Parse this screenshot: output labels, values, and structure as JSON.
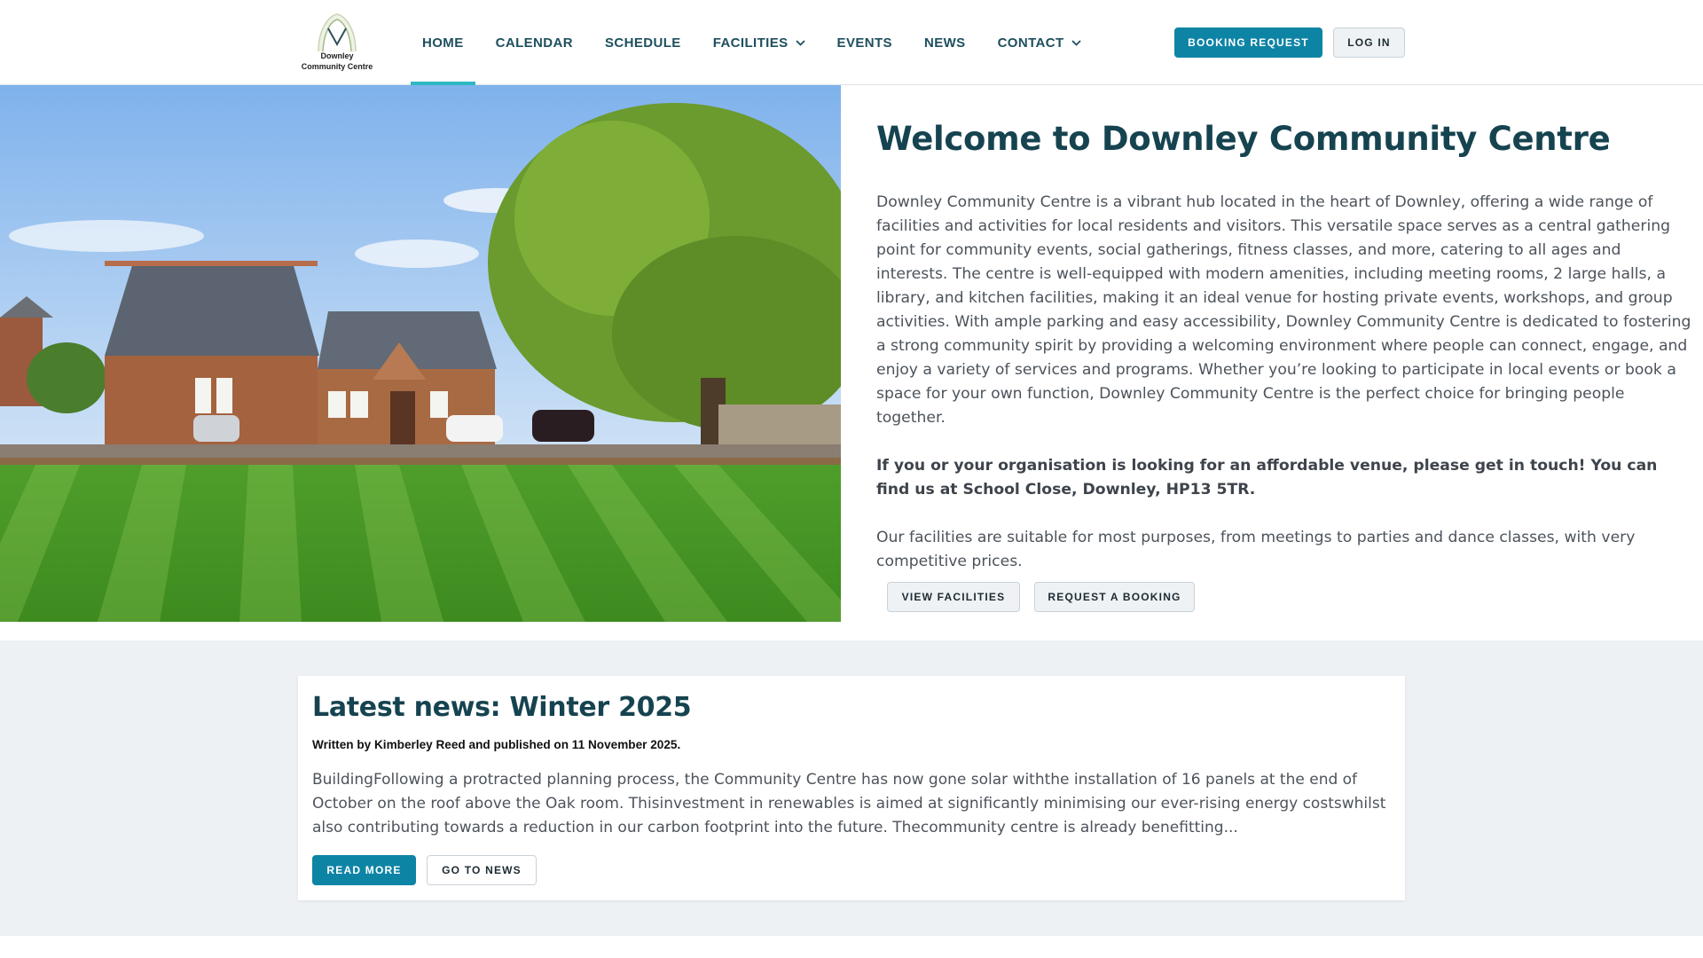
{
  "logo": {
    "line1": "Downley",
    "line2": "Community Centre"
  },
  "nav": {
    "items": [
      {
        "label": "HOME",
        "active": true
      },
      {
        "label": "CALENDAR"
      },
      {
        "label": "SCHEDULE"
      },
      {
        "label": "FACILITIES",
        "dropdown": true
      },
      {
        "label": "EVENTS"
      },
      {
        "label": "NEWS"
      },
      {
        "label": "CONTACT",
        "dropdown": true
      }
    ],
    "booking_label": "BOOKING REQUEST",
    "login_label": "LOG IN"
  },
  "hero": {
    "title": "Welcome to Downley Community Centre",
    "paragraph1": "Downley Community Centre is a vibrant hub located in the heart of Downley, offering a wide range of facilities and activities for local residents and visitors. This versatile space serves as a central gathering point for community events, social gatherings, fitness classes, and more, catering to all ages and interests. The centre is well-equipped with modern amenities, including meeting rooms, 2 large halls, a library, and kitchen facilities, making it an ideal venue for hosting private events, workshops, and group activities. With ample parking and easy accessibility, Downley Community Centre is dedicated to fostering a strong community spirit by providing a welcoming environment where people can connect, engage, and enjoy a variety of services and programs. Whether you’re looking to participate in local events or book a space for your own function, Downley Community Centre is the perfect choice for bringing people together.",
    "paragraph2": "If you or your organisation is looking for an affordable venue, please get in touch! You can find us at School Close, Downley, HP13 5TR.",
    "paragraph3": "Our facilities are suitable for most purposes, from meetings to parties and dance classes, with very competitive prices.",
    "view_facilities_label": "VIEW FACILITIES",
    "request_booking_label": "REQUEST A BOOKING"
  },
  "news": {
    "title": "Latest news: Winter 2025",
    "meta": "Written by Kimberley Reed and published on 11 November 2025.",
    "body": "BuildingFollowing a protracted planning process, the Community Centre has now gone solar withthe installation of 16 panels at the end of October on the roof above the Oak room. Thisinvestment in renewables is aimed at significantly minimising our ever-rising energy costswhilst also contributing towards a reduction in our carbon footprint into the future. Thecommunity centre is already benefitting...",
    "read_more_label": "READ MORE",
    "go_to_news_label": "GO TO NEWS"
  },
  "colors": {
    "accent": "#0e84a5",
    "heading": "#164350",
    "nav_text": "#1e4f5e",
    "active_underline": "#2eb8c2",
    "news_band": "#edf1f4"
  },
  "icons": {
    "logo": "arch-logo-icon",
    "dropdown": "chevron-down-icon"
  }
}
